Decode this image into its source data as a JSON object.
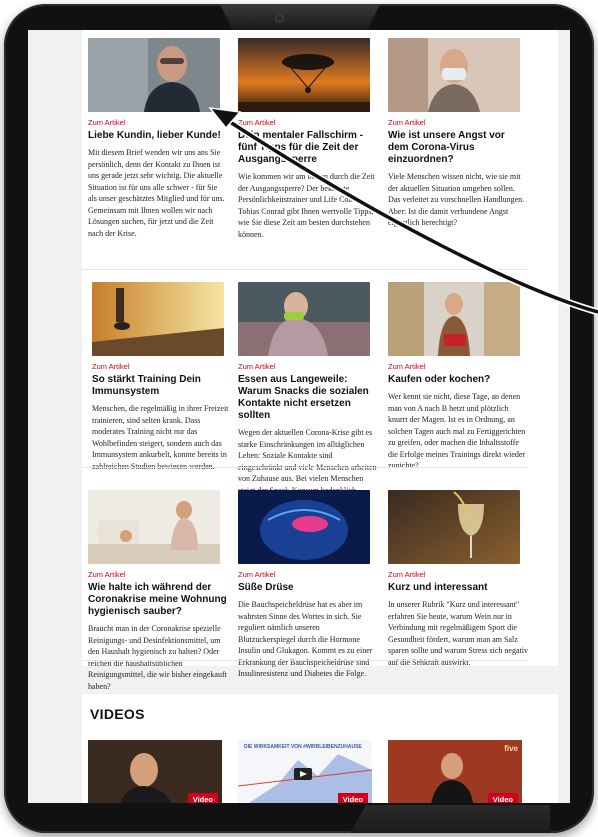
{
  "articles": [
    {
      "category": "Zum Artikel",
      "title": "Liebe Kundin, lieber Kunde!",
      "text": "Mit diesem Brief wenden wir uns ans Sie persönlich, denn der Kontakt zu Ihnen ist uns gerade jetzt sehr wichtig. Die aktuelle Situation ist für uns alle schwer - für Sie als unser geschätztes Mitglied und für uns. Gemeinsam mit Ihnen wollen wir nach Lösungen suchen, für jetzt und die Zeit nach der Krise."
    },
    {
      "category": "Zum Artikel",
      "title": "Dein mentaler Fallschirm - fünf Tipps für die Zeit der Ausgangssperre",
      "text": "Wie kommen wir am besten durch die Zeit der Ausgangssperre? Der bekannte Persönlichkeitstrainer und Life Coach Tobias Conrad gibt Ihnen wertvolle Tipps, wie Sie diese Zeit am besten durchstehen können."
    },
    {
      "category": "Zum Artikel",
      "title": "Wie ist unsere Angst vor dem Corona-Virus einzuordnen?",
      "text": "Viele Menschen wissen nicht, wie sie mit der aktuellen Situation umgehen sollen. Das verleitet zu vorschnellen Handlungen. Aber: Ist die damit verbundene Angst eigentlich berechtigt?"
    },
    {
      "category": "Zum Artikel",
      "title": "So stärkt Training Dein Immunsystem",
      "text": "Menschen, die regelmäßig in ihrer Freizeit trainieren, sind selten krank. Dass moderates Training nicht nur das Wohlbefinden steigert, sondern auch das Immunsystem ankurbelt, konnte bereits in zahlreichen Studien bewiesen werden."
    },
    {
      "category": "Zum Artikel",
      "title": "Essen aus Langeweile: Warum Snacks die sozialen Kontakte nicht ersetzen sollten",
      "text": "Wegen der aktuellen Corona-Krise gibt es starke Einschränkungen im alltäglichen Leben: Soziale Kontakte sind eingeschränkt und viele Menschen arbeiten von Zuhause aus. Bei vielen Menschen steigt der Snack-Konsum bedenklich."
    },
    {
      "category": "Zum Artikel",
      "title": "Kaufen oder kochen?",
      "text": "Wer kennt sie nicht, diese Tage, an denen man von A nach B hetzt und plötzlich knurrt der Magen. Ist es in Ordnung, an solchen Tagen auch mal zu Fertiggerichten zu greifen, oder machen die Inhaltsstoffe die Erfolge meines Trainings direkt wieder zunichte?"
    },
    {
      "category": "Zum Artikel",
      "title": "Wie halte ich während der Coronakrise meine Wohnung hygienisch sauber?",
      "text": "Braucht man in der Coronakrise spezielle Reinigungs- und Desinfektionsmittel, um den Haushalt hygienisch zu halten? Oder reichen die haushaltsüblichen Reinigungsmittel, die wir bisher eingekauft haben?"
    },
    {
      "category": "Zum Artikel",
      "title": "Süße Drüse",
      "text": "Die Bauchspeicheldrüse hat es aber im wahrsten Sinne des Wortes in sich. Sie reguliert nämlich unseren Blutzuckerspiegel durch die Hormone Insulin und Glukagon. Kommt es zu einer Erkrankung der Bauchspeicheldrüse sind Insulinresistenz und Diabetes die Folge."
    },
    {
      "category": "Zum Artikel",
      "title": "Kurz und interessant",
      "text": "In unserer Rubrik \"Kurz und interessant\" erfahren Sie heute, warum Wein nur in Verbindung mit regelmäßigem Sport die Gesundheit fördert, warum man am Salz sparen sollte und warum Stress sich negativ auf die Sehkraft auswirkt."
    }
  ],
  "videos": {
    "heading": "VIDEOS",
    "items": [
      {
        "badge": "Video"
      },
      {
        "badge": "Video",
        "label": "DIE WIRKSAMKEIT VON #WIRBLEIBENZUHAUSE"
      },
      {
        "badge": "Video",
        "label": "five"
      }
    ]
  },
  "colors": {
    "accent": "#d0021b",
    "frame": "#111111",
    "background": "#f1f1f1"
  }
}
